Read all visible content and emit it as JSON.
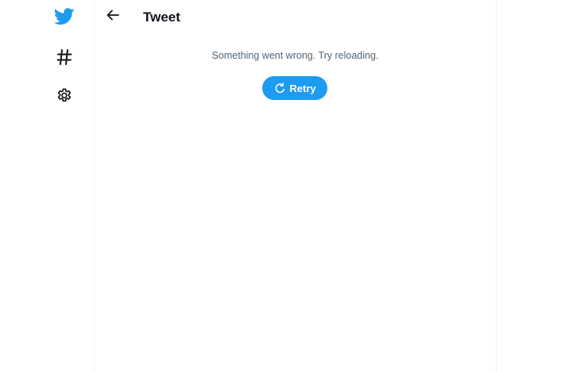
{
  "sidebar": {
    "icons": [
      "twitter-bird-icon",
      "hashtag-icon",
      "gear-icon"
    ]
  },
  "header": {
    "back_icon": "arrow-left-icon",
    "title": "Tweet"
  },
  "main": {
    "error_message": "Something went wrong. Try reloading.",
    "retry_label": "Retry",
    "retry_icon": "refresh-icon"
  },
  "colors": {
    "brand": "#1d9bf0",
    "text_primary": "#0f1419",
    "text_secondary": "#536471",
    "border": "#eff3f4",
    "background": "#ffffff"
  }
}
